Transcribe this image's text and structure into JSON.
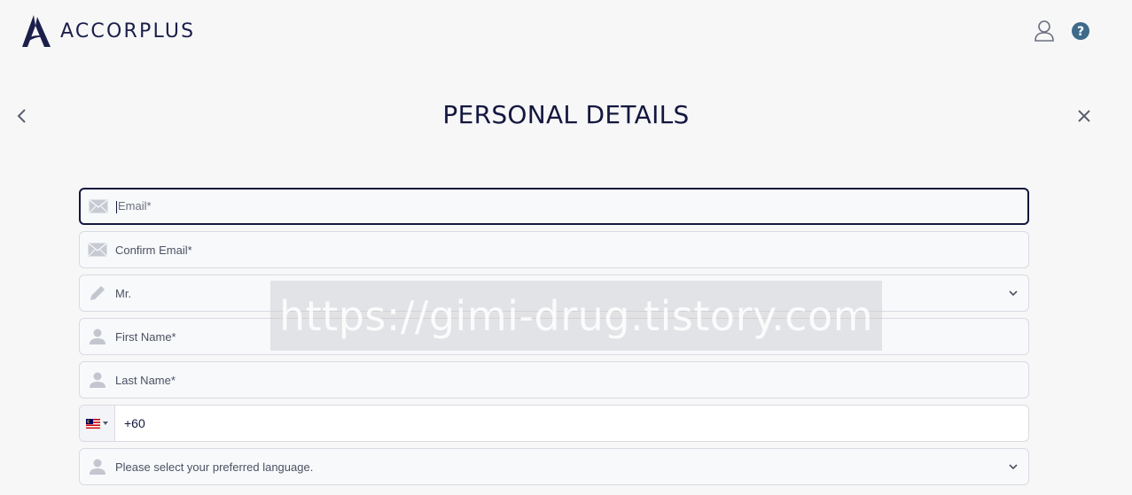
{
  "brand": {
    "name": "ACCORPLUS"
  },
  "header": {
    "account_icon": "user-account-icon",
    "help_icon": "help-icon"
  },
  "page": {
    "title": "PERSONAL DETAILS"
  },
  "form": {
    "email_placeholder": "Email*",
    "confirm_email_placeholder": "Confirm Email*",
    "title_value": "Mr.",
    "first_name_placeholder": "First Name*",
    "last_name_placeholder": "Last Name*",
    "phone_country_flag": "malaysia-flag",
    "phone_value": "+60",
    "language_placeholder": "Please select your preferred language."
  },
  "watermark": {
    "text": "https://gimi-drug.tistory.com"
  },
  "colors": {
    "brand_navy": "#14173f",
    "background": "#f7f7f8",
    "border": "#d9dbe2",
    "icon_gray": "#c3c6cf"
  }
}
